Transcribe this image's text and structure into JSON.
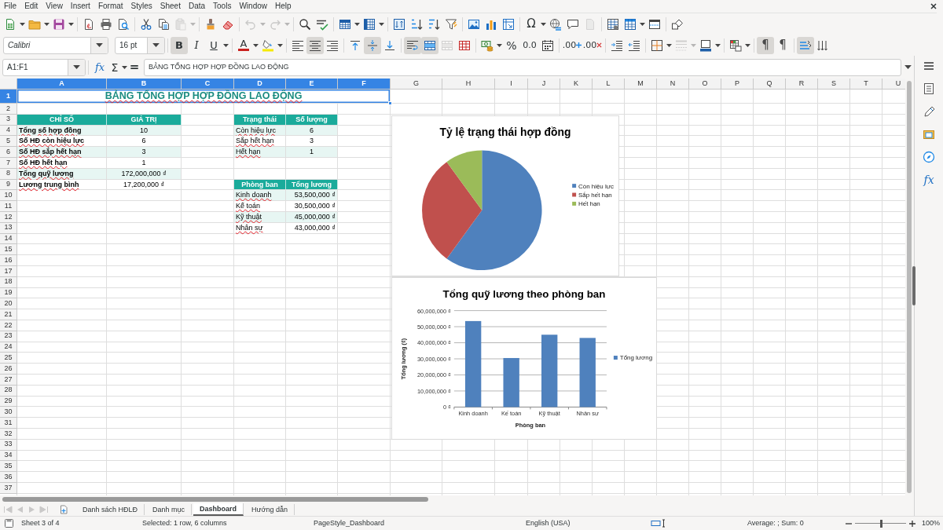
{
  "menu_bar": [
    "File",
    "Edit",
    "View",
    "Insert",
    "Format",
    "Styles",
    "Sheet",
    "Data",
    "Tools",
    "Window",
    "Help"
  ],
  "standard_toolbar": {
    "paste": {
      "disabled": true
    },
    "undo": {
      "disabled": true
    },
    "redo": {
      "disabled": true
    },
    "special_character": "Ω",
    "headers_footers": {
      "disabled": true
    }
  },
  "formatting_toolbar": {
    "font_name": "Calibri",
    "font_size": "16 pt",
    "text_styles": [
      {
        "label": "B",
        "pressed": true
      },
      {
        "label": "I",
        "pressed": false
      },
      {
        "label": "U",
        "pressed": false
      }
    ],
    "font_color": "A",
    "horizontal_alignment": [
      {
        "pressed": false
      },
      {
        "pressed": true
      },
      {
        "pressed": false
      }
    ],
    "vertical_alignment": [
      {
        "pressed": false
      },
      {
        "pressed": true
      },
      {
        "pressed": false
      }
    ],
    "wrap_text": {
      "pressed": true
    },
    "merge_and_center": {
      "pressed": true
    },
    "merge_cells": {
      "disabled": true
    },
    "percent": "%",
    "number_format": "0.0",
    "decimal_places": [
      ".00",
      ".00"
    ],
    "border_style": {
      "disabled": true
    },
    "paragraph_direction": [
      {
        "label": "¶",
        "pressed": true
      },
      {
        "label": "¶",
        "pressed": false
      }
    ],
    "text_direction": [
      {
        "pressed": true
      },
      {
        "pressed": false
      }
    ]
  },
  "formula_bar": {
    "name_box": "A1:F1",
    "function_wizard": "fx",
    "sum": "Σ",
    "formula": "=",
    "content": "BẢNG TỔNG HỢP HỢP ĐỒNG LAO ĐỘNG"
  },
  "sidebar": {
    "functions": "fx"
  },
  "sheet": {
    "columns": [
      {
        "label": "A",
        "selected": true
      },
      {
        "label": "B",
        "selected": true
      },
      {
        "label": "C",
        "selected": true
      },
      {
        "label": "D",
        "selected": true
      },
      {
        "label": "E",
        "selected": true
      },
      {
        "label": "F",
        "selected": true
      },
      {
        "label": "G",
        "selected": false
      },
      {
        "label": "H",
        "selected": false
      },
      {
        "label": "I",
        "selected": false
      },
      {
        "label": "J",
        "selected": false
      },
      {
        "label": "K",
        "selected": false
      },
      {
        "label": "L",
        "selected": false
      },
      {
        "label": "M",
        "selected": false
      },
      {
        "label": "N",
        "selected": false
      },
      {
        "label": "O",
        "selected": false
      },
      {
        "label": "P",
        "selected": false
      },
      {
        "label": "Q",
        "selected": false
      },
      {
        "label": "R",
        "selected": false
      },
      {
        "label": "S",
        "selected": false
      },
      {
        "label": "T",
        "selected": false
      },
      {
        "label": "U",
        "selected": false
      }
    ],
    "rows": [
      {
        "label": "1",
        "selected": true
      },
      {
        "label": "2",
        "selected": false
      },
      {
        "label": "3",
        "selected": false
      },
      {
        "label": "4",
        "selected": false
      },
      {
        "label": "5",
        "selected": false
      },
      {
        "label": "6",
        "selected": false
      },
      {
        "label": "7",
        "selected": false
      },
      {
        "label": "8",
        "selected": false
      },
      {
        "label": "9",
        "selected": false
      },
      {
        "label": "10",
        "selected": false
      },
      {
        "label": "11",
        "selected": false
      },
      {
        "label": "12",
        "selected": false
      },
      {
        "label": "13",
        "selected": false
      },
      {
        "label": "14",
        "selected": false
      },
      {
        "label": "15",
        "selected": false
      },
      {
        "label": "16",
        "selected": false
      },
      {
        "label": "17",
        "selected": false
      },
      {
        "label": "18",
        "selected": false
      },
      {
        "label": "19",
        "selected": false
      },
      {
        "label": "20",
        "selected": false
      },
      {
        "label": "21",
        "selected": false
      },
      {
        "label": "22",
        "selected": false
      },
      {
        "label": "23",
        "selected": false
      },
      {
        "label": "24",
        "selected": false
      },
      {
        "label": "25",
        "selected": false
      },
      {
        "label": "26",
        "selected": false
      },
      {
        "label": "27",
        "selected": false
      },
      {
        "label": "28",
        "selected": false
      },
      {
        "label": "29",
        "selected": false
      },
      {
        "label": "30",
        "selected": false
      },
      {
        "label": "31",
        "selected": false
      },
      {
        "label": "32",
        "selected": false
      },
      {
        "label": "33",
        "selected": false
      },
      {
        "label": "34",
        "selected": false
      },
      {
        "label": "35",
        "selected": false
      },
      {
        "label": "36",
        "selected": false
      },
      {
        "label": "37",
        "selected": false
      }
    ],
    "spelling_marks": true,
    "title": {
      "text": "BẢNG TỔNG HỢP HỢP ĐỒNG LAO ĐỘNG",
      "selected": true
    },
    "tables": [
      {
        "header": [
          "CHỈ SỐ",
          "GIÁ TRỊ"
        ],
        "banded": true,
        "rows": [
          [
            "Tổng số hợp đồng",
            "10"
          ],
          [
            "Số HĐ còn hiệu lực",
            "6"
          ],
          [
            "Số HĐ sắp hết hạn",
            "3"
          ],
          [
            "Số HĐ hết hạn",
            "1"
          ],
          [
            "Tổng quỹ lương",
            "172,000,000 ₫"
          ],
          [
            "Lương trung bình",
            "17,200,000 ₫"
          ]
        ]
      },
      {
        "header": [
          "Trạng thái",
          "Số lượng"
        ],
        "banded": true,
        "rows": [
          [
            "Còn hiệu lực",
            "6"
          ],
          [
            "Sắp hết hạn",
            "3"
          ],
          [
            "Hết hạn",
            "1"
          ]
        ]
      },
      {
        "header": [
          "Phòng ban",
          "Tổng lương"
        ],
        "banded": true,
        "rows": [
          [
            "Kinh doanh",
            "53,500,000 ₫"
          ],
          [
            "Kế toán",
            "30,500,000 ₫"
          ],
          [
            "Kỹ thuật",
            "45,000,000 ₫"
          ],
          [
            "Nhân sự",
            "43,000,000 ₫"
          ]
        ]
      }
    ],
    "pie_chart": {
      "chart_data": {
        "type": "pie",
        "title": "Tỷ lệ trạng thái hợp đồng",
        "categories": [
          "Còn hiệu lực",
          "Sắp hết hạn",
          "Hết hạn"
        ],
        "values": [
          60,
          30,
          10
        ],
        "colors": [
          "#4f81bd",
          "#c0504d",
          "#9bbb59"
        ],
        "legend": "right"
      }
    },
    "bar_chart": {
      "chart_data": {
        "type": "bar",
        "title": "Tổng quỹ lương theo phòng ban",
        "xlabel": "Phòng ban",
        "ylabel": "Tổng lương (₫)",
        "categories": [
          "Kinh doanh",
          "Kế toán",
          "Kỹ thuật",
          "Nhân sự"
        ],
        "series": [
          {
            "name": "Tổng lương",
            "color": "#4f81bd",
            "values": [
              53500000,
              30500000,
              45000000,
              43000000
            ]
          }
        ],
        "ylim": [
          0,
          60000000
        ],
        "yticks": [
          {
            "value": 0,
            "label": "0 ₫"
          },
          {
            "value": 10000000,
            "label": "10,000,000 ₫"
          },
          {
            "value": 20000000,
            "label": "20,000,000 ₫"
          },
          {
            "value": 30000000,
            "label": "30,000,000 ₫"
          },
          {
            "value": 40000000,
            "label": "40,000,000 ₫"
          },
          {
            "value": 50000000,
            "label": "50,000,000 ₫"
          },
          {
            "value": 60000000,
            "label": "60,000,000 ₫"
          }
        ],
        "grid": true,
        "legend": "right"
      }
    }
  },
  "sheet_navigation": [
    {
      "disabled": true
    },
    {
      "disabled": true
    },
    {
      "disabled": true
    },
    {
      "disabled": true
    }
  ],
  "sheet_tabs": [
    {
      "label": "Danh sách HĐLĐ",
      "selected": false
    },
    {
      "label": "Danh mục",
      "selected": false
    },
    {
      "label": "Dashboard",
      "selected": true
    },
    {
      "label": "Hướng dẫn",
      "selected": false
    }
  ],
  "status_bar": {
    "sheet": "Sheet 3 of 4",
    "selection": "Selected: 1 row, 6 columns",
    "page_style": "PageStyle_Dashboard",
    "language": "English (USA)",
    "summary": "Average: ; Sum: 0",
    "zoom_slider": {
      "level": 0.5
    },
    "zoom": "100%"
  }
}
